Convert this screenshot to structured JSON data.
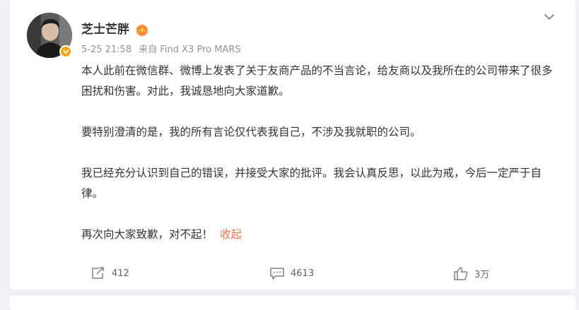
{
  "post": {
    "author": "芝士芒胖",
    "timestamp": "5-25 21:58",
    "source": "来自 Find X3 Pro MARS",
    "paragraphs": [
      "本人此前在微信群、微博上发表了关于友商产品的不当言论，给友商以及我所在的公司带来了很多困扰和伤害。对此，我诚恳地向大家道歉。",
      "要特别澄清的是，我的所有言论仅代表我自己，不涉及我就职的公司。",
      "我已经充分认识到自己的错误，并接受大家的批评。我会认真反思，以此为戒，今后一定严于自律。",
      "再次向大家致歉，对不起！"
    ],
    "collapse_label": "收起"
  },
  "actions": {
    "repost_count": "412",
    "comment_count": "4613",
    "like_count": "3万"
  },
  "icons": {
    "verified": "verified-badge-icon",
    "member": "crown-member-icon",
    "more": "chevron-down-icon",
    "repost": "repost-icon",
    "comment": "comment-icon",
    "like": "thumbs-up-icon"
  },
  "colors": {
    "accent": "#eb7350",
    "verified": "#f3a40d",
    "meta_text": "#939393",
    "background": "#f1f2f5"
  }
}
